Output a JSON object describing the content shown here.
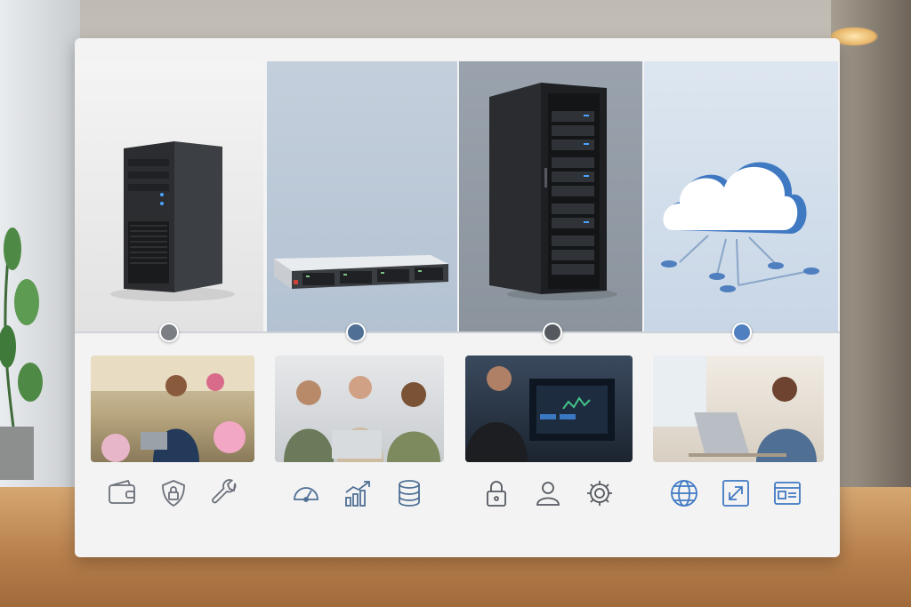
{
  "scene": {
    "description_free": true
  },
  "tiers": [
    {
      "id": "tower-server",
      "dot_color": "#7b7e82",
      "icons": [
        "wallet-icon",
        "shield-lock-icon",
        "wrench-icon"
      ],
      "icon_color": "#6b7079"
    },
    {
      "id": "rack-server",
      "dot_color": "#4f6f94",
      "icons": [
        "speedometer-icon",
        "growth-chart-icon",
        "database-icon"
      ],
      "icon_color": "#4f6f94"
    },
    {
      "id": "server-cabinet",
      "dot_color": "#55595f",
      "icons": [
        "padlock-icon",
        "user-icon",
        "gear-icon"
      ],
      "icon_color": "#55595f"
    },
    {
      "id": "cloud",
      "dot_color": "#4f7fbf",
      "icons": [
        "globe-icon",
        "expand-icon",
        "window-icon"
      ],
      "icon_color": "#3f79c2"
    }
  ],
  "colors": {
    "panel": "#f3f3f4",
    "cloud_blue": "#3f79c2"
  }
}
